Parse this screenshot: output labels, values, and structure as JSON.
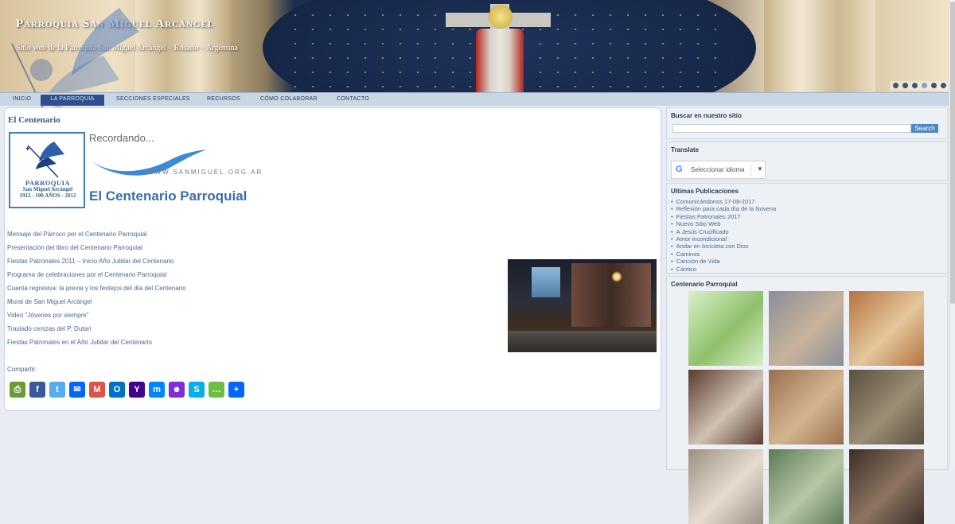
{
  "header": {
    "site_title": "Parroquia San Miguel Arcángel",
    "tagline": "Sitio web de la Parroquia San Miguel Arcángel – Rosario – Argentina",
    "slider_dots": 6
  },
  "nav": {
    "items": [
      "INICIO",
      "LA PARROQUIA",
      "SECCIONES ESPECIALES",
      "RECURSOS",
      "CÓMO COLABORAR",
      "CONTACTO"
    ],
    "active_index": 1
  },
  "main": {
    "title": "El Centenario",
    "banner": {
      "recordando": "Recordando...",
      "url": "WWW.SANMIGUEL.ORG.AR",
      "heading": "El Centenario Parroquial",
      "logo_line1": "PARROQUIA",
      "logo_line2": "San Miguel Arcángel",
      "logo_line3": "1912 - 100 AÑOS - 2012"
    },
    "links": [
      "Mensaje del Párroco por el Centenario Parroquial",
      "Presentación del libro del Centenario Parroquial",
      "Fiestas Patronales 2011 – Inicio Año Jubilar del Centenario",
      "Programa de celebraciones por el Centenario Parroquial",
      "Cuenta regresiva: la previa y los festejos del día del Centenario",
      "Mural de San Miguel Arcángel",
      "Video \"Jóvenes por siempre\"",
      "Traslado cenizas del P. Dutari",
      "Fiestas Patronales en el Año Jubilar del Centenario"
    ],
    "share_label": "Compartir:",
    "share_buttons": [
      {
        "name": "print",
        "glyph": "⎙",
        "color": "#6a9c32"
      },
      {
        "name": "facebook",
        "glyph": "f",
        "color": "#3b5998"
      },
      {
        "name": "twitter",
        "glyph": "t",
        "color": "#55acee"
      },
      {
        "name": "email",
        "glyph": "✉",
        "color": "#0166ff"
      },
      {
        "name": "gmail",
        "glyph": "M",
        "color": "#dd5347"
      },
      {
        "name": "outlook",
        "glyph": "O",
        "color": "#0072c6"
      },
      {
        "name": "yahoo",
        "glyph": "Y",
        "color": "#400090"
      },
      {
        "name": "messenger",
        "glyph": "m",
        "color": "#0084ff"
      },
      {
        "name": "mewe",
        "glyph": "☻",
        "color": "#7b2fd8"
      },
      {
        "name": "skype",
        "glyph": "S",
        "color": "#00aff0"
      },
      {
        "name": "sms",
        "glyph": "…",
        "color": "#6cbe45"
      },
      {
        "name": "share",
        "glyph": "+",
        "color": "#0166ff"
      }
    ]
  },
  "sidebar": {
    "search": {
      "title": "Buscar en nuestro sitio",
      "button": "Search",
      "value": ""
    },
    "translate": {
      "title": "Translate",
      "label": "Seleccionar idioma",
      "g": "G",
      "arrow": "▼"
    },
    "posts": {
      "title": "Ultimas Publicaciones",
      "items": [
        "Comunicándonos 17-08-2017",
        "Reflexión para cada día de la Novena",
        "Fiestas Patronales 2017",
        "Nuevo Sitio Web",
        "A Jesús Crucificado",
        "Amor incondicional",
        "Andar en bicicleta con Dios",
        "Caminos",
        "Canción de Vida",
        "Cántico"
      ]
    },
    "gallery": {
      "title": "Centenario Parroquial",
      "thumbs": [
        {
          "name": "gallery-thumb-poster",
          "colors": [
            "#d8efc9",
            "#8fc06a"
          ]
        },
        {
          "name": "gallery-thumb-mosaic-hands",
          "colors": [
            "#8a8e9a",
            "#c8b39a"
          ]
        },
        {
          "name": "gallery-thumb-archangel-mosaic",
          "colors": [
            "#b5723f",
            "#e4c79c"
          ]
        },
        {
          "name": "gallery-thumb-group-photo",
          "colors": [
            "#5b3b2e",
            "#cfc2b3"
          ]
        },
        {
          "name": "gallery-thumb-mosaic-work",
          "colors": [
            "#9b6f4d",
            "#d3b58f"
          ]
        },
        {
          "name": "gallery-thumb-scaffold",
          "colors": [
            "#5a5040",
            "#9c8e74"
          ]
        },
        {
          "name": "gallery-thumb-interior-1",
          "colors": [
            "#9a8f82",
            "#e6ddd0"
          ]
        },
        {
          "name": "gallery-thumb-interior-2",
          "colors": [
            "#5d7a55",
            "#b7c7a5"
          ]
        },
        {
          "name": "gallery-thumb-interior-3",
          "colors": [
            "#3b2f2a",
            "#8d7560"
          ]
        }
      ]
    }
  }
}
